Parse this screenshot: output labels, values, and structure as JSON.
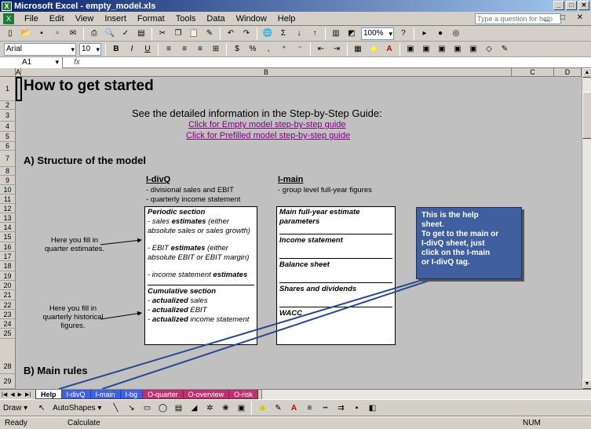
{
  "window": {
    "title": "Microsoft Excel - empty_model.xls",
    "min": "_",
    "max": "□",
    "close": "✕"
  },
  "menu": {
    "items": [
      "File",
      "Edit",
      "View",
      "Insert",
      "Format",
      "Tools",
      "Data",
      "Window",
      "Help"
    ],
    "help_placeholder": "Type a question for help"
  },
  "toolbar": {
    "zoom": "100%",
    "font": "Arial",
    "size": "10",
    "bold": "B",
    "italic": "I",
    "underline": "U"
  },
  "formula": {
    "cell_ref": "A1",
    "fx": "fx",
    "value": ""
  },
  "columns": [
    "A",
    "B",
    "C",
    "D"
  ],
  "rows": [
    "1",
    "2",
    "3",
    "4",
    "5",
    "6",
    "7",
    "8",
    "9",
    "10",
    "11",
    "12",
    "13",
    "14",
    "15",
    "16",
    "17",
    "18",
    "19",
    "20",
    "21",
    "22",
    "23",
    "24",
    "25",
    "28",
    "29"
  ],
  "sheet": {
    "title": "How to get started",
    "guide_intro": "See the detailed information in the Step-by-Step Guide:",
    "link_empty": "Click for Empty model step-by-step guide",
    "link_prefilled": "Click for Prefilled model step-by-step guide",
    "section_a": "A) Structure of the model",
    "idivq_title": "I-divQ",
    "idivq_sub1": "- divisional sales and EBIT",
    "idivq_sub2": "- quarterly income statement",
    "imain_title": "I-main",
    "imain_sub1": "- group level full-year figures",
    "note1_l1": "Here you fill in",
    "note1_l2": "quarter estimates.",
    "note2_l1": "Here you fill in",
    "note2_l2": "quarterly historical",
    "note2_l3": "figures.",
    "box1": {
      "h1": "Periodic section",
      "l1a": "- sales ",
      "l1b": "estimates",
      "l1c": " (either",
      "l2": "absolute sales or sales growth)",
      "l3a": "- EBIT ",
      "l3b": "estimates",
      "l3c": " (either",
      "l4": "absolute EBIT or EBIT margin)",
      "l5a": "- income statement ",
      "l5b": "estimates",
      "h2": "Cumulative section",
      "l6a": "- ",
      "l6b": "actualized",
      "l6c": " sales",
      "l7a": "- ",
      "l7b": "actualized",
      "l7c": " EBIT",
      "l8a": "- ",
      "l8b": "actualized",
      "l8c": " income statement"
    },
    "box2": {
      "h1": "Main full-year estimate",
      "h1b": "parameters",
      "h2": "Income statement",
      "h3": "Balance sheet",
      "h4": "Shares and dividends",
      "h5": "WACC"
    },
    "callout": {
      "l1": "This is the help",
      "l2": "sheet.",
      "l3": "To get to the main or",
      "l4": "I-divQ sheet, just",
      "l5": "click on the I-main",
      "l6": "or I-divQ tag."
    },
    "section_b": "B) Main rules"
  },
  "tabs": [
    {
      "label": "Help",
      "color": "#ffff80"
    },
    {
      "label": "I-divQ",
      "color": "#4060e0"
    },
    {
      "label": "I-main",
      "color": "#4060e0"
    },
    {
      "label": "I-bg",
      "color": "#4060e0"
    },
    {
      "label": "O-quarter",
      "color": "#c03070"
    },
    {
      "label": "O-overview",
      "color": "#c03070"
    },
    {
      "label": "O-risk",
      "color": "#c03070"
    }
  ],
  "drawbar": {
    "draw": "Draw",
    "autoshapes": "AutoShapes"
  },
  "status": {
    "ready": "Ready",
    "calculate": "Calculate",
    "num": "NUM"
  }
}
